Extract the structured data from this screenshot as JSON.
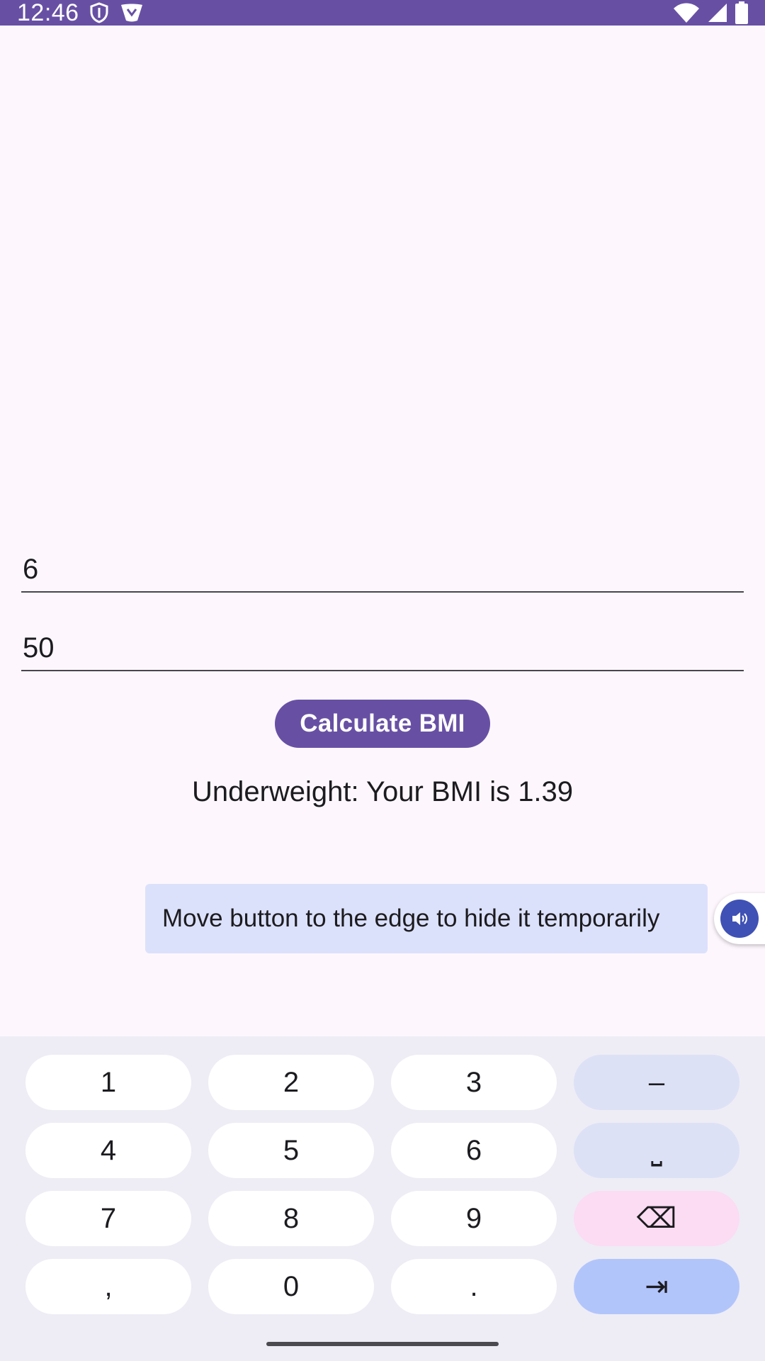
{
  "status_bar": {
    "time": "12:46",
    "left_icons": [
      "shield-icon",
      "vpn-key-icon"
    ],
    "right_icons": [
      "wifi-icon",
      "cell-signal-icon",
      "battery-icon"
    ],
    "color": "#6750a4"
  },
  "form": {
    "height_value": "6",
    "weight_value": "50",
    "calculate_label": "Calculate BMI",
    "result_text": "Underweight: Your BMI is 1.39"
  },
  "tooltip": {
    "text": "Move button to the edge to hide it temporarily",
    "button_icon": "accessibility-volume-icon"
  },
  "keyboard": {
    "keys": [
      "1",
      "2",
      "3",
      "–",
      "4",
      "5",
      "6",
      "⎵",
      "7",
      "8",
      "9",
      "⌫",
      ",",
      "0",
      ".",
      "⇥"
    ]
  },
  "colors": {
    "primary": "#6750a4",
    "background": "#fdf7fd",
    "tooltip_bg": "#dce1fb",
    "key_func": "#dde1f6",
    "key_delete": "#fbdcf2",
    "key_action": "#b2c5fb"
  }
}
